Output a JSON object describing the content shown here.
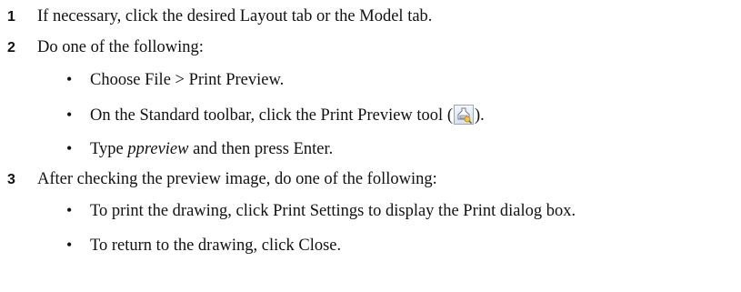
{
  "steps": [
    {
      "number": "1",
      "text": "If necessary, click the desired Layout tab or the Model tab."
    },
    {
      "number": "2",
      "text": "Do one of the following:"
    },
    {
      "number": "3",
      "text": "After checking the preview image, do one of the following:"
    }
  ],
  "step2_bullets": {
    "b1": "Choose File > Print Preview.",
    "b2_before": "On the Standard toolbar, click the Print Preview tool (",
    "b2_icon": "print-preview-icon",
    "b2_after": ").",
    "b3_italic": "ppreview",
    "b3_after": " and then press Enter.",
    "b3_before": "Type "
  },
  "step3_bullets": {
    "b1": "To print the drawing, click Print Settings to display the Print dialog box.",
    "b2": "To return to the drawing, click Close."
  },
  "bullet_glyph": "•"
}
